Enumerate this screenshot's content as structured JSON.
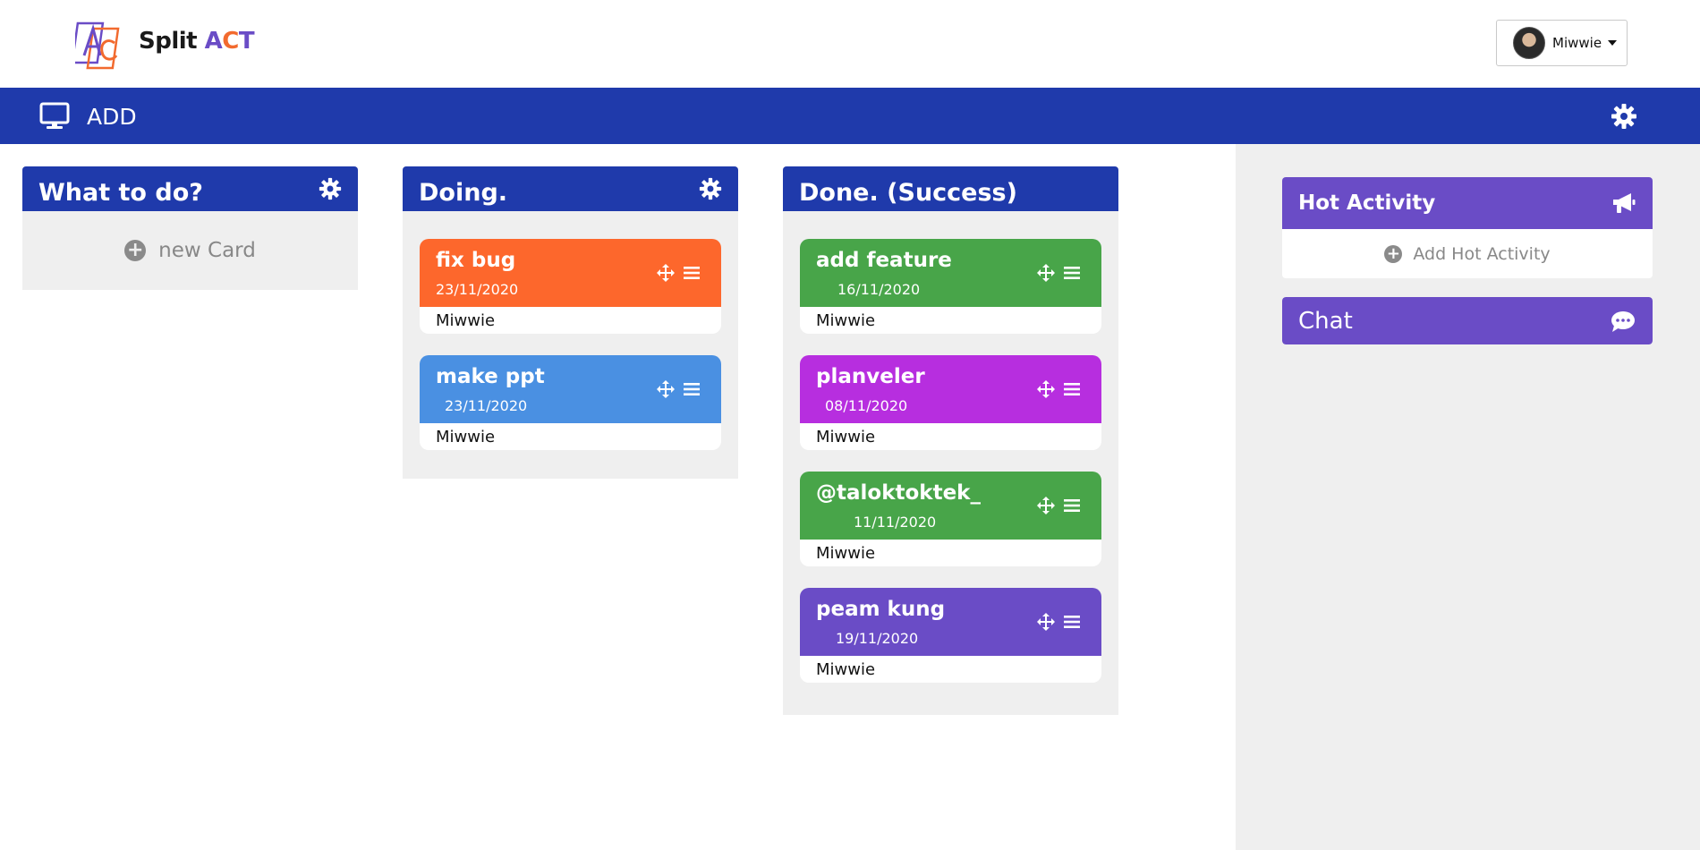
{
  "header": {
    "brand_prefix": "Split ",
    "brand_a": "A",
    "brand_c": "C",
    "brand_t": "T",
    "user": {
      "name": "Miwwie"
    }
  },
  "toolbar": {
    "title": "ADD",
    "color": "#1f3aab"
  },
  "columns": [
    {
      "title": "What to do?",
      "new_card_label": "new Card",
      "cards": []
    },
    {
      "title": "Doing.",
      "cards": [
        {
          "title": " fix bug",
          "date": "23/11/2020",
          "owner": "Miwwie",
          "color": "#fd672c"
        },
        {
          "title": "make ppt",
          "date": "23/11/2020",
          "owner": "Miwwie",
          "color": "#4a90e2"
        }
      ]
    },
    {
      "title": "Done. (Success)",
      "cards": [
        {
          "title": "add feature",
          "date": "16/11/2020",
          "owner": "Miwwie",
          "color": "#48a549"
        },
        {
          "title": "planveler",
          "date": "08/11/2020",
          "owner": "Miwwie",
          "color": "#b72edf"
        },
        {
          "title": "@taloktoktek_",
          "date": "11/11/2020",
          "owner": "Miwwie",
          "color": "#48a549"
        },
        {
          "title": "peam kung",
          "date": "19/11/2020",
          "owner": "Miwwie",
          "color": "#6a4cc6"
        }
      ]
    }
  ],
  "sidebar": {
    "hot_activity": {
      "title": "Hot Activity",
      "add_label": "Add Hot Activity",
      "icon": "megaphone-icon"
    },
    "chat": {
      "title": "Chat",
      "icon": "chat-bubble-icon"
    }
  },
  "colors": {
    "accent": "#6a4cc6",
    "board_blue": "#1f3aab",
    "panel_bg": "#efefef"
  }
}
